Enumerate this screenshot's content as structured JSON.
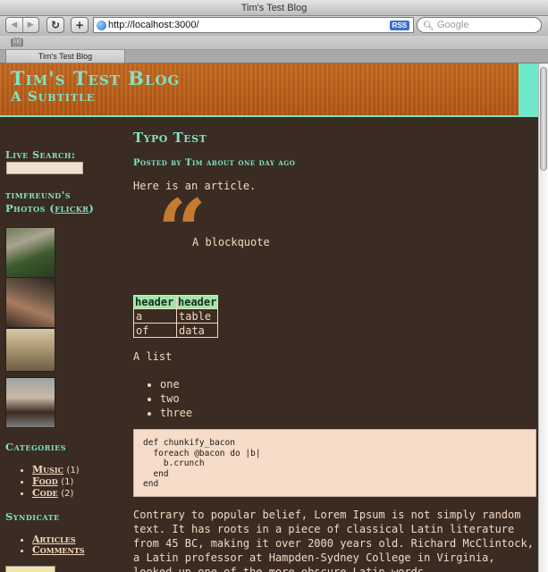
{
  "window": {
    "title": "Tim's Test Blog"
  },
  "toolbar": {
    "back": "◀",
    "forward": "▶",
    "reload": "↻",
    "add": "+",
    "url": "http://localhost:3000/",
    "rss": "RSS",
    "search_placeholder": "Google"
  },
  "tabs": [
    {
      "label": "Tim's Test Blog"
    }
  ],
  "blog": {
    "title": "Tim's Test Blog",
    "subtitle": "A Subtitle"
  },
  "sidebar": {
    "live_search_label": "Live Search:",
    "photos_heading": "timfreund's",
    "photos_heading_2": "Photos",
    "flickr_link": "flickr",
    "categories_heading": "Categories",
    "categories": [
      {
        "name": "Music",
        "count": "(1)"
      },
      {
        "name": "Food",
        "count": "(1)"
      },
      {
        "name": "Code",
        "count": "(2)"
      }
    ],
    "syndicate_heading": "Syndicate",
    "syndicate": [
      {
        "name": "Articles"
      },
      {
        "name": "Comments"
      }
    ]
  },
  "post": {
    "title": "Typo Test",
    "meta": "Posted by Tim about one day ago",
    "intro": "Here is an article.",
    "blockquote": "A blockquote",
    "table": {
      "headers": [
        "header",
        "header"
      ],
      "rows": [
        [
          "a",
          "table"
        ],
        [
          "of",
          "data"
        ]
      ]
    },
    "list_label": "A list",
    "list_items": [
      "one",
      "two",
      "three"
    ],
    "code": "def chunkify_bacon\n  foreach @bacon do |b|\n    b.crunch\n  end\nend",
    "paragraph": "Contrary to popular belief, Lorem Ipsum is not simply random text. It has roots in a piece of classical Latin literature from 45 BC, making it over 2000 years old. Richard McClintock, a Latin professor at Hampden-Sydney College in Virginia, looked up one of the more obscure Latin words"
  },
  "colors": {
    "page_bg": "#3a2c22",
    "header_bg": "#c46a22",
    "accent": "#7fe3c7",
    "text": "#f3d8c2"
  }
}
